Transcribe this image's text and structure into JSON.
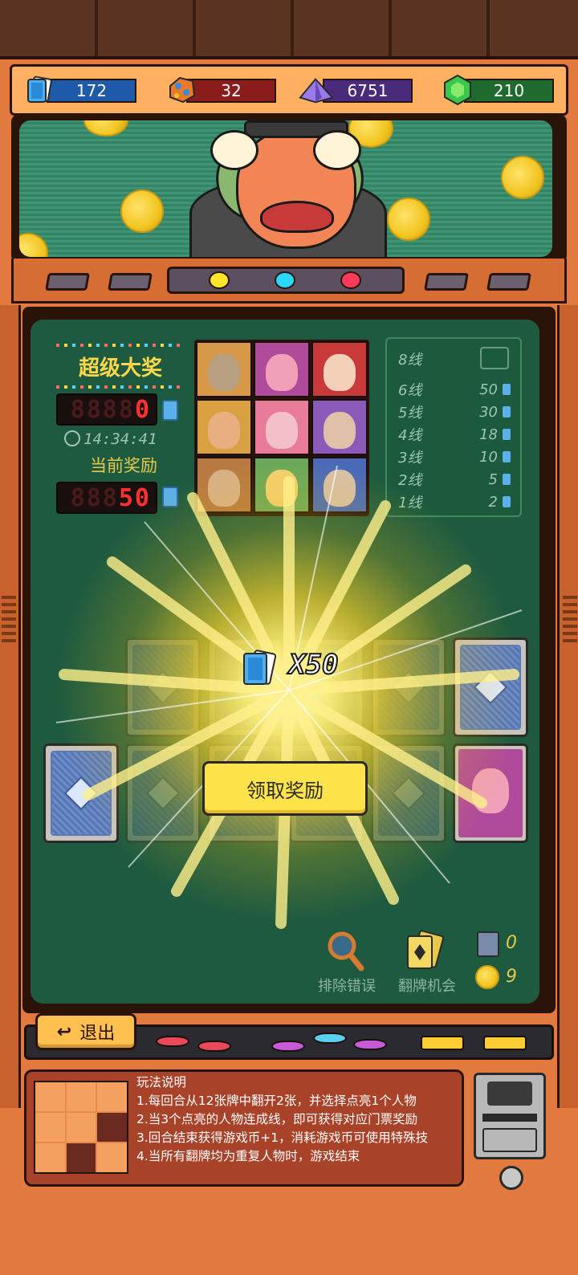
{
  "currencies": [
    {
      "icon": "ticket-icon",
      "value": "172",
      "color": "#1f5aa8"
    },
    {
      "icon": "ore-icon",
      "value": "32",
      "color": "#8a1c1c"
    },
    {
      "icon": "purple-crystal-icon",
      "value": "6751",
      "color": "#4a2a7a"
    },
    {
      "icon": "green-gem-icon",
      "value": "210",
      "color": "#1f6a2e"
    }
  ],
  "lamps": [
    "#ffe62a",
    "#2ad8ff",
    "#ff3a5a"
  ],
  "jackpot": {
    "title": "超级大奖",
    "value_dim": "8888",
    "value_lit": "0",
    "timer": "14:34:41",
    "current_label": "当前奖励",
    "current_dim": "888",
    "current_lit": "50"
  },
  "payout": [
    {
      "label": "8线",
      "value": ""
    },
    {
      "label": "6线",
      "value": "50"
    },
    {
      "label": "5线",
      "value": "30"
    },
    {
      "label": "4线",
      "value": "18"
    },
    {
      "label": "3线",
      "value": "10"
    },
    {
      "label": "2线",
      "value": "5"
    },
    {
      "label": "1线",
      "value": "2"
    }
  ],
  "reward": {
    "multiplier": "X50",
    "claim_label": "领取奖励"
  },
  "tools": {
    "eliminate_label": "排除错误",
    "flip_label": "翻牌机会",
    "card_count": "0",
    "coin_count": "9"
  },
  "exit_label": "退出",
  "rules": {
    "title": "玩法说明",
    "lines": [
      "1.每回合从12张牌中翻开2张，并选择点亮1个人物",
      "2.当3个点亮的人物连成线，即可获得对应门票奖励",
      "3.回合结束获得游戏币+1，消耗游戏币可使用特殊技",
      "4.当所有翻牌均为重复人物时，游戏结束"
    ]
  }
}
